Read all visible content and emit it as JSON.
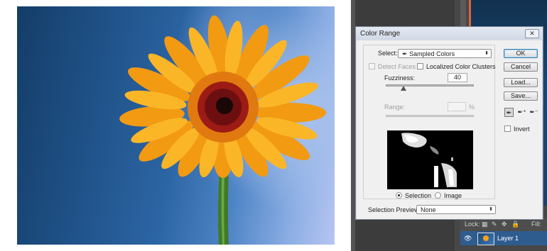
{
  "dialog": {
    "title": "Color Range",
    "close_label": "✕",
    "select_label": "Select:",
    "select_value": "Sampled Colors",
    "detect_faces_label": "Detect Faces",
    "localized_label": "Localized Color Clusters",
    "fuzziness_label": "Fuzziness:",
    "fuzziness_value": "40",
    "range_label": "Range:",
    "range_unit": "%",
    "selection_radio": "Selection",
    "image_radio": "Image",
    "preview_label": "Selection Preview:",
    "preview_value": "None",
    "buttons": {
      "ok": "OK",
      "cancel": "Cancel",
      "load": "Load...",
      "save": "Save..."
    },
    "invert_label": "Invert"
  },
  "layers": {
    "lock_label": "Lock:",
    "fill_label": "Fill:",
    "layer_name": "Layer 1"
  },
  "icons": [
    "eyedropper-icon",
    "eyedropper-plus-icon",
    "eyedropper-minus-icon",
    "eye-icon",
    "lock-icon"
  ]
}
